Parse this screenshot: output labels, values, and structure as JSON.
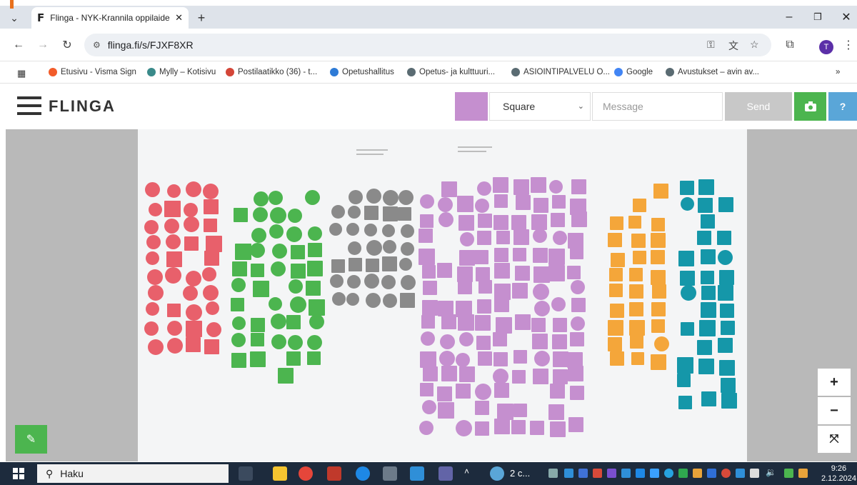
{
  "browser": {
    "tab_title": "Flinga - NYK-Krannila oppilaide",
    "tab_favicon": "F",
    "url": "flinga.fi/s/FJXF8XR",
    "profile_initial": "T",
    "bookmarks": [
      {
        "label": "Etusivu - Visma Sign",
        "color": "#f25c2a"
      },
      {
        "label": "Mylly – Kotisivu",
        "color": "#3a8a8a"
      },
      {
        "label": "Postilaatikko (36) - t...",
        "color": "#d44638"
      },
      {
        "label": "Opetushallitus",
        "color": "#2e7bd6"
      },
      {
        "label": "Opetus- ja kulttuuri...",
        "color": "#5a6b72"
      },
      {
        "label": "ASIOINTIPALVELU O...",
        "color": "#5a6b72"
      },
      {
        "label": "Google",
        "color": "#4285f4"
      },
      {
        "label": "Avustukset – avin av...",
        "color": "#5a6b72"
      }
    ],
    "bookmarks_overflow": "»"
  },
  "flinga": {
    "logo": "FLINGA",
    "shape_value": "Square",
    "message_placeholder": "Message",
    "send_label": "Send",
    "help_label": "?",
    "swatch_color": "#c58fcf"
  },
  "board": {
    "colors": {
      "red": "#e8606b",
      "green": "#4cb54f",
      "gray": "#8a8a8a",
      "purple": "#c58fcf",
      "orange": "#f4a63a",
      "teal": "#1597a9"
    }
  },
  "zoom": {
    "in": "+",
    "out": "−",
    "fit": "⤧"
  },
  "taskbar": {
    "search_label": "Haku",
    "app_label": "2 c...",
    "time": "9:26",
    "date": "2.12.2024"
  }
}
